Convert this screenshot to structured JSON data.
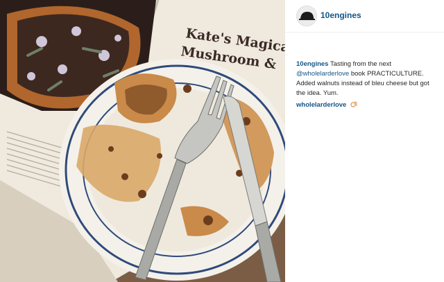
{
  "post": {
    "username": "10engines",
    "caption": {
      "username": "10engines",
      "text_before": "Tasting from the next",
      "mention": "@wholelarderlove",
      "text_after": "book PRACTICULTURE. Added walnuts instead of bleu cheese but got the idea. Yum."
    },
    "comment": {
      "username": "wholelarderlove",
      "icon": "ok-hand-icon"
    }
  },
  "photo": {
    "book_title_line1": "Kate's Magica",
    "book_title_line2": "Mushroom &"
  }
}
